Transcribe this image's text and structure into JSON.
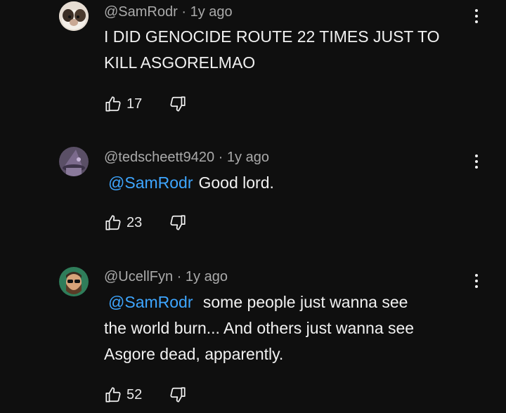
{
  "comments": [
    {
      "author": "@SamRodr",
      "age": "1y ago",
      "mention": "",
      "text_lines": [
        "I DID GENOCIDE ROUTE 22 TIMES JUST TO",
        "KILL ASGORELMAO"
      ],
      "likes": "17",
      "avatar": "guinea-pig"
    },
    {
      "author": "@tedscheett9420",
      "age": "1y ago",
      "mention": "@SamRodr",
      "text_lines": [
        "Good lord."
      ],
      "likes": "23",
      "avatar": "wizard"
    },
    {
      "author": "@UcellFyn",
      "age": "1y ago",
      "mention": "@SamRodr",
      "text_lines": [
        "some people just wanna see",
        "the world burn... And others just wanna see",
        "Asgore dead, apparently."
      ],
      "likes": "52",
      "avatar": "bearded-man"
    }
  ],
  "separator": "·",
  "colors": {
    "background": "#0f0f0f",
    "mention": "#3ea6ff",
    "meta": "#aaaaaa"
  },
  "icons": {
    "like": "thumbs-up-icon",
    "dislike": "thumbs-down-icon",
    "menu": "more-vert-icon"
  }
}
